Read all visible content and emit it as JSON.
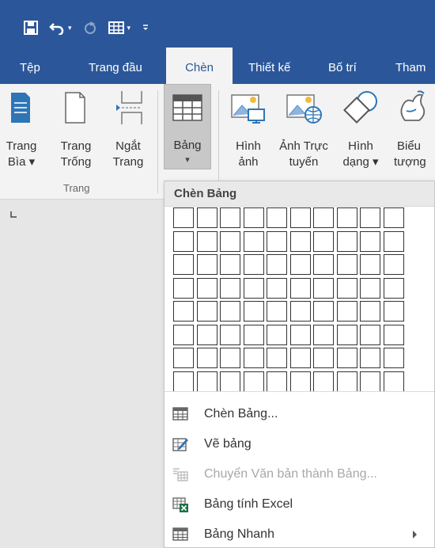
{
  "tabs": [
    {
      "label": "Tệp"
    },
    {
      "label": "Trang đầu"
    },
    {
      "label": "Chèn"
    },
    {
      "label": "Thiết kế"
    },
    {
      "label": "Bố trí"
    },
    {
      "label": "Tham"
    }
  ],
  "active_tab": "Chèn",
  "ribbon": {
    "trang_bia": {
      "line1": "Trang",
      "line2": "Bìa ▾"
    },
    "trang_trong": {
      "line1": "Trang",
      "line2": "Trống"
    },
    "ngat_trang": {
      "line1": "Ngắt",
      "line2": "Trang"
    },
    "group_trang": "Trang",
    "bang": {
      "line1": "Bảng",
      "caret": "▾"
    },
    "hinh_anh": {
      "line1": "Hình",
      "line2": "ảnh"
    },
    "anh_truc_tuyen": {
      "line1": "Ảnh Trực",
      "line2": "tuyến"
    },
    "hinh_dang": {
      "line1": "Hình",
      "line2": "dạng ▾"
    },
    "bieu_tuong": {
      "line1": "Biểu",
      "line2": "tượng"
    }
  },
  "dropdown": {
    "title": "Chèn Bảng",
    "grid": {
      "columns": 10,
      "rows": 8
    },
    "items": [
      {
        "label": "Chèn Bảng...",
        "icon": "table-icon",
        "enabled": true
      },
      {
        "label": "Vẽ bảng",
        "icon": "pencil-table-icon",
        "enabled": true
      },
      {
        "label": "Chuyển Văn bản thành Bảng...",
        "icon": "text-to-table-icon",
        "enabled": false
      },
      {
        "label": "Bảng tính Excel",
        "icon": "excel-icon",
        "enabled": true
      },
      {
        "label": "Bảng Nhanh",
        "icon": "quick-table-icon",
        "enabled": true,
        "submenu": true
      }
    ]
  },
  "colors": {
    "title_bar": "#2b579a",
    "ribbon_bg": "#f3f3f3",
    "accent_icon": "#2e75b6",
    "excel_green": "#1e7145"
  }
}
